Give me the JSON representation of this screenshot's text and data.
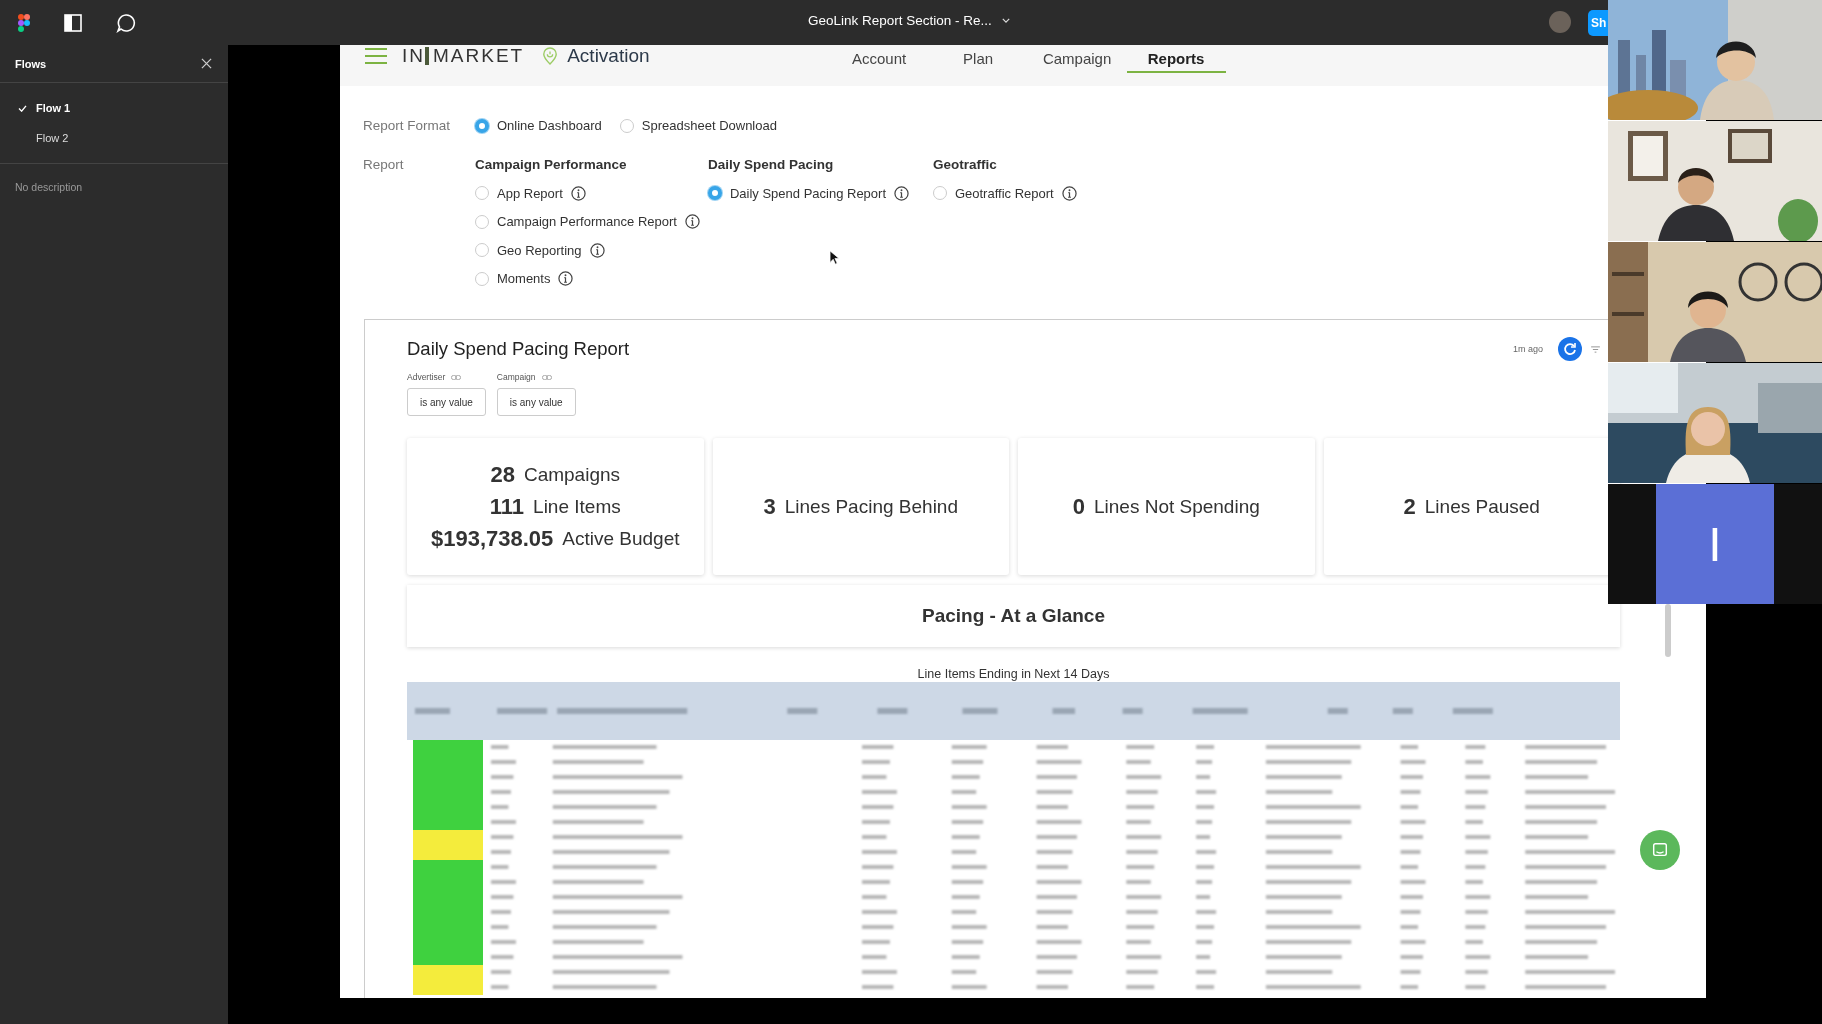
{
  "toolbar": {
    "title": "GeoLink Report Section - Re...",
    "share_label": "Sh"
  },
  "flows_panel": {
    "title": "Flows",
    "flows": [
      {
        "label": "Flow 1",
        "selected": true
      },
      {
        "label": "Flow 2",
        "selected": false
      }
    ],
    "description": "No description"
  },
  "app": {
    "logo": {
      "part_1": "IN",
      "part_2": "MARKET"
    },
    "product": "Activation",
    "nav_tabs": [
      {
        "label": "Account",
        "selected": false
      },
      {
        "label": "Plan",
        "selected": false
      },
      {
        "label": "Campaign",
        "selected": false
      },
      {
        "label": "Reports",
        "selected": true
      }
    ],
    "report_format": {
      "label": "Report Format",
      "options": [
        {
          "label": "Online Dashboard",
          "selected": true
        },
        {
          "label": "Spreadsheet Download",
          "selected": false
        }
      ]
    },
    "report": {
      "label": "Report",
      "groups": [
        {
          "title": "Campaign Performance",
          "options": [
            {
              "label": "App Report",
              "selected": false
            },
            {
              "label": "Campaign Performance Report",
              "selected": false
            },
            {
              "label": "Geo Reporting",
              "selected": false
            },
            {
              "label": "Moments",
              "selected": false
            }
          ]
        },
        {
          "title": "Daily Spend Pacing",
          "options": [
            {
              "label": "Daily Spend Pacing Report",
              "selected": true
            }
          ]
        },
        {
          "title": "Geotraffic",
          "options": [
            {
              "label": "Geotraffic Report",
              "selected": false
            }
          ]
        }
      ]
    },
    "dashboard": {
      "title": "Daily Spend Pacing Report",
      "updated": "1m ago",
      "filters": [
        {
          "label": "Advertiser",
          "value": "is any value"
        },
        {
          "label": "Campaign",
          "value": "is any value"
        }
      ],
      "kpis": [
        {
          "lines": [
            {
              "count": "28",
              "noun": "Campaigns"
            },
            {
              "count": "111",
              "noun": "Line Items"
            },
            {
              "count": "$193,738.05",
              "noun": "Active Budget"
            }
          ]
        },
        {
          "lines": [
            {
              "count": "3",
              "noun": "Lines Pacing Behind"
            }
          ]
        },
        {
          "lines": [
            {
              "count": "0",
              "noun": "Lines Not Spending"
            }
          ]
        },
        {
          "lines": [
            {
              "count": "2",
              "noun": "Lines Paused"
            }
          ]
        }
      ],
      "section_title": "Pacing - At a Glance",
      "table_title": "Line Items Ending in Next 14 Days",
      "table_rows": [
        {
          "color": "#3fd13f"
        },
        {
          "color": "#3fd13f"
        },
        {
          "color": "#3fd13f"
        },
        {
          "color": "#3fd13f"
        },
        {
          "color": "#3fd13f"
        },
        {
          "color": "#3fd13f"
        },
        {
          "color": "#f4ec3c"
        },
        {
          "color": "#f4ec3c"
        },
        {
          "color": "#3fd13f"
        },
        {
          "color": "#3fd13f"
        },
        {
          "color": "#3fd13f"
        },
        {
          "color": "#3fd13f"
        },
        {
          "color": "#3fd13f"
        },
        {
          "color": "#3fd13f"
        },
        {
          "color": "#3fd13f"
        },
        {
          "color": "#f4ec3c"
        },
        {
          "color": "#f4ec3c"
        }
      ]
    }
  },
  "participants": [
    {
      "kind": "video"
    },
    {
      "kind": "video"
    },
    {
      "kind": "video"
    },
    {
      "kind": "video"
    },
    {
      "kind": "initial",
      "initial": "I"
    }
  ]
}
